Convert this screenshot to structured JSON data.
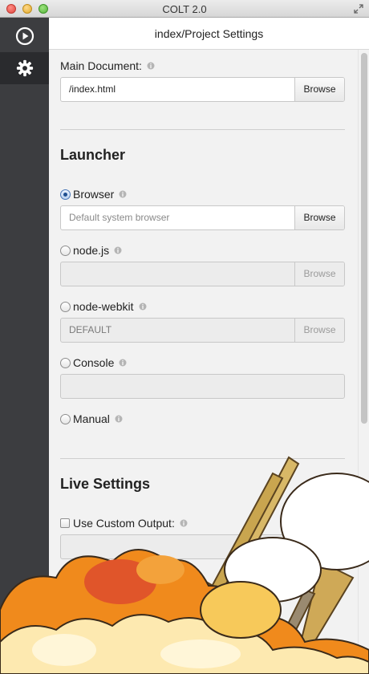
{
  "window": {
    "title": "COLT 2.0"
  },
  "sidebar": {
    "items": [
      {
        "name": "run",
        "icon": "play-icon",
        "active": false
      },
      {
        "name": "settings",
        "icon": "gear-icon",
        "active": true
      }
    ]
  },
  "header": {
    "title": "index/Project Settings"
  },
  "main_document": {
    "label": "Main Document:",
    "value": "/index.html",
    "browse_label": "Browse"
  },
  "launcher": {
    "title": "Launcher",
    "options": [
      {
        "label": "Browser",
        "selected": true,
        "value": "",
        "placeholder": "Default system browser",
        "browse_label": "Browse",
        "enabled": true
      },
      {
        "label": "node.js",
        "selected": false,
        "value": "",
        "placeholder": "",
        "browse_label": "Browse",
        "enabled": false
      },
      {
        "label": "node-webkit",
        "selected": false,
        "value": "DEFAULT",
        "placeholder": "",
        "browse_label": "Browse",
        "enabled": false
      },
      {
        "label": "Console",
        "selected": false,
        "value": "",
        "placeholder": "",
        "enabled": false
      },
      {
        "label": "Manual",
        "selected": false
      }
    ]
  },
  "live_settings": {
    "title": "Live Settings",
    "custom_output": {
      "label": "Use Custom Output:",
      "checked": false,
      "value": ""
    }
  },
  "colors": {
    "sidebar_bg": "#3c3d40",
    "sidebar_active": "#2a2b2e",
    "content_bg": "#f2f2f2",
    "radio_accent": "#1f4f90",
    "art_orange": "#f08a1c",
    "art_red": "#e0552a",
    "art_cream": "#fde9b0"
  }
}
